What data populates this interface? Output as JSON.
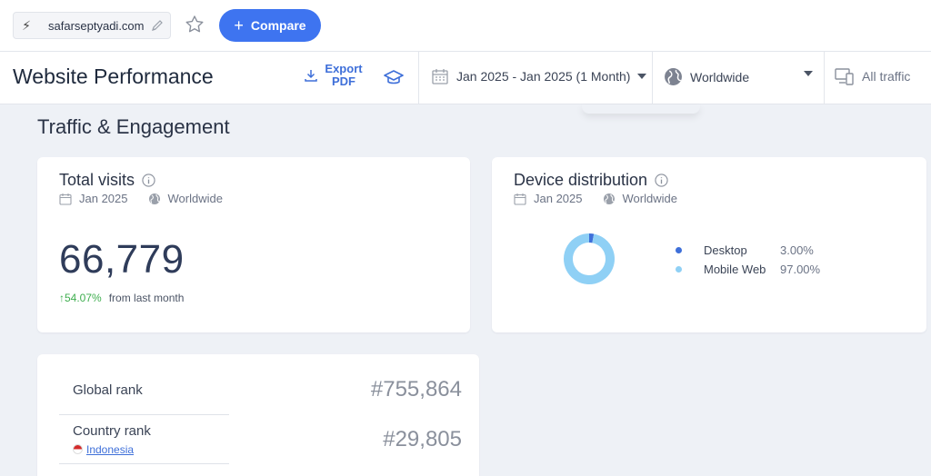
{
  "topbar": {
    "domain": "safarseptyadi.com",
    "compare_label": "Compare"
  },
  "header": {
    "title": "Website Performance",
    "export_label": "Export PDF",
    "date_range": "Jan 2025 - Jan 2025 (1 Month)",
    "geo": "Worldwide",
    "traffic": "All traffic"
  },
  "section": {
    "title": "Traffic & Engagement"
  },
  "total_visits": {
    "title": "Total visits",
    "date": "Jan 2025",
    "geo": "Worldwide",
    "value": "66,779",
    "change_pct": "54.07%",
    "change_text": "from last month"
  },
  "device": {
    "title": "Device distribution",
    "date": "Jan 2025",
    "geo": "Worldwide",
    "items": [
      {
        "name": "Desktop",
        "value": "3.00%",
        "share": 3.0,
        "color": "#3e6fd9"
      },
      {
        "name": "Mobile Web",
        "value": "97.00%",
        "share": 97.0,
        "color": "#8fd0f5"
      }
    ]
  },
  "ranks": {
    "global_label": "Global rank",
    "global_value": "#755,864",
    "country_label": "Country rank",
    "country_name": "Indonesia",
    "country_value": "#29,805"
  },
  "colors": {
    "accent": "#3e74f0",
    "positive": "#3fae4f"
  }
}
